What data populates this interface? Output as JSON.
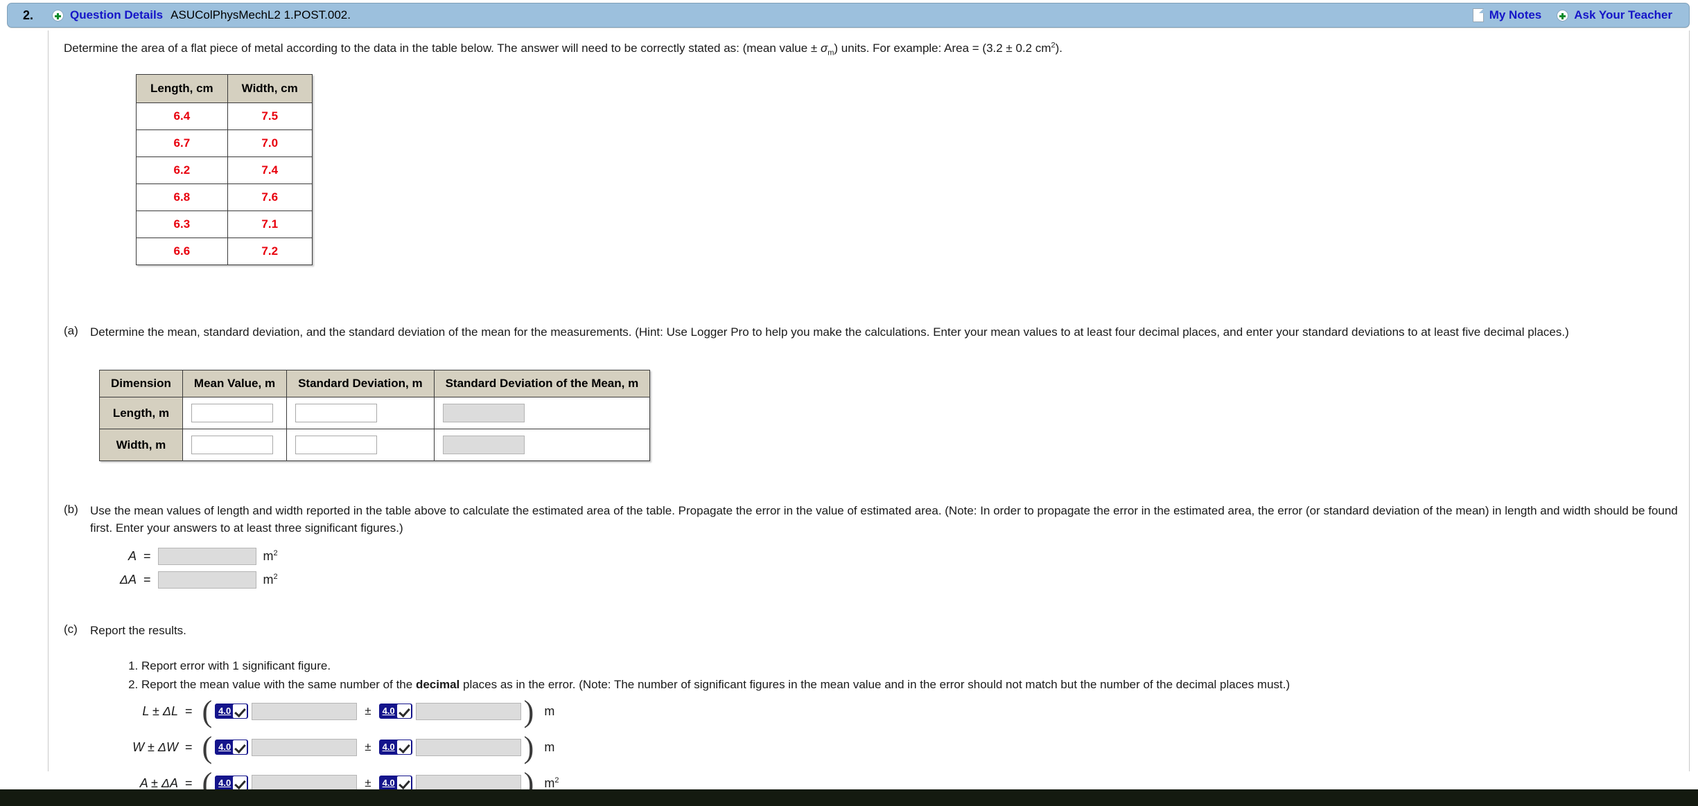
{
  "header": {
    "question_number": "2.",
    "expand_icon": "plus-circle-icon",
    "details_label": "Question Details",
    "question_code": "ASUColPhysMechL2 1.POST.002.",
    "notes_icon": "note-page-icon",
    "my_notes_label": "My Notes",
    "teacher_icon": "plus-circle-icon",
    "ask_teacher_label": "Ask Your Teacher",
    "bar_color": "#9cc0dd",
    "link_color": "#1515c8"
  },
  "intro": {
    "part1": "Determine the area of a flat piece of metal according to the data in the table below. The answer will need to be correctly stated as: (mean value ± ",
    "sigma": "σ",
    "sigma_sub": "m",
    "part2": ") units. For example: Area = (3.2 ± 0.2 cm",
    "exponent": "2",
    "part3": ")."
  },
  "measurement_table": {
    "headers": [
      "Length, cm",
      "Width, cm"
    ],
    "rows": [
      [
        "6.4",
        "7.5"
      ],
      [
        "6.7",
        "7.0"
      ],
      [
        "6.2",
        "7.4"
      ],
      [
        "6.8",
        "7.6"
      ],
      [
        "6.3",
        "7.1"
      ],
      [
        "6.6",
        "7.2"
      ]
    ],
    "header_bg": "#d5d0c0",
    "value_color": "#e8000d"
  },
  "part_a": {
    "label": "(a)",
    "text": "Determine the mean, standard deviation, and the standard deviation of the mean for the measurements. (Hint: Use Logger Pro to help you make the calculations. Enter your mean values to at least four decimal places, and enter your standard deviations to at least five decimal places.)",
    "table": {
      "headers": [
        "Dimension",
        "Mean Value, m",
        "Standard Deviation, m",
        "Standard Deviation of the Mean, m"
      ],
      "rows": [
        {
          "dimension": "Length, m",
          "mean_value": "",
          "std_dev": "",
          "std_dev_mean": ""
        },
        {
          "dimension": "Width, m",
          "mean_value": "",
          "std_dev": "",
          "std_dev_mean": ""
        }
      ]
    }
  },
  "part_b": {
    "label": "(b)",
    "text": "Use the mean values of length and width reported in the table above to calculate the estimated area of the table. Propagate the error in the value of estimated area. (Note: In order to propagate the error in the estimated area, the error (or standard deviation of the mean) in length and width should be found first. Enter your answers to at least three significant figures.)",
    "rows": [
      {
        "symbol": "A",
        "equals": "=",
        "value": "",
        "unit": "m",
        "unit_exp": "2"
      },
      {
        "symbol": "ΔA",
        "equals": "=",
        "value": "",
        "unit": "m",
        "unit_exp": "2"
      }
    ]
  },
  "part_c": {
    "label": "(c)",
    "text": "Report the results.",
    "list": [
      "Report error with 1 significant figure.",
      "Report the mean value with the same number of the decimal places as in the error. (Note: The number of significant figures in the mean value and in the error should not match but the number of the decimal places must.)"
    ],
    "list_item2_pre": "Report the mean value with the same number of the ",
    "list_item2_bold": "decimal",
    "list_item2_post": " places as in the error. (Note: The number of significant figures in the mean value and in the error should not match but the number of the decimal places must.)",
    "sig_badge": {
      "value": "4.0",
      "check": "checkmark-icon",
      "bg": "#15158c"
    },
    "rows": [
      {
        "symbol": "L ± ΔL",
        "equals": "=",
        "open": "(",
        "mean_value": "",
        "pm": "±",
        "error_value": "",
        "close": ")",
        "unit": "m",
        "unit_exp": ""
      },
      {
        "symbol": "W ± ΔW",
        "equals": "=",
        "open": "(",
        "mean_value": "",
        "pm": "±",
        "error_value": "",
        "close": ")",
        "unit": "m",
        "unit_exp": ""
      },
      {
        "symbol": "A ± ΔA",
        "equals": "=",
        "open": "(",
        "mean_value": "",
        "pm": "±",
        "error_value": "",
        "close": ")",
        "unit": "m",
        "unit_exp": "2"
      }
    ]
  }
}
